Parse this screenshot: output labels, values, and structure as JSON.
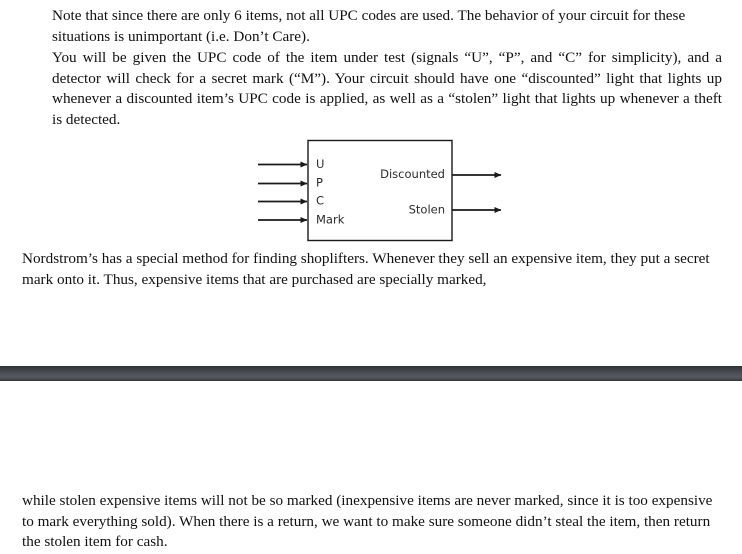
{
  "document": {
    "paragraphs": {
      "note": "Note that since there are only 6 items, not all UPC codes are used.  The behavior of your circuit for these situations is unimportant (i.e. Don’t Care).",
      "upc": "You will be given the UPC code of the item under test (signals “U”, “P”, and “C” for simplicity), and a detector will check for a secret mark (“M”). Your circuit should have one “discounted” light that lights up whenever a discounted item’s UPC code is applied, as well as a “stolen” light that lights up whenever a theft is detected.",
      "nordstrom": "Nordstrom’s has a special method for finding shoplifters. Whenever they sell an expensive item, they put a secret mark onto it. Thus, expensive items that are purchased are specially marked,",
      "while": "while stolen expensive items will not be so marked (inexpensive items are never marked, since it is too expensive to mark everything sold). When there is a return, we want to make sure someone didn’t steal the item, then return the stolen item for cash."
    }
  },
  "diagram": {
    "type": "block-diagram",
    "inputs": [
      {
        "label": "U"
      },
      {
        "label": "P"
      },
      {
        "label": "C"
      },
      {
        "label": "Mark"
      }
    ],
    "outputs": [
      {
        "label": "Discounted"
      },
      {
        "label": "Stolen"
      }
    ],
    "box_stroke": "#1a1a1a",
    "line_color": "#1a1a1a"
  },
  "divider": {
    "color_top": "#2f3438",
    "color_mid": "#55595d",
    "color_bottom": "#2c3034"
  }
}
